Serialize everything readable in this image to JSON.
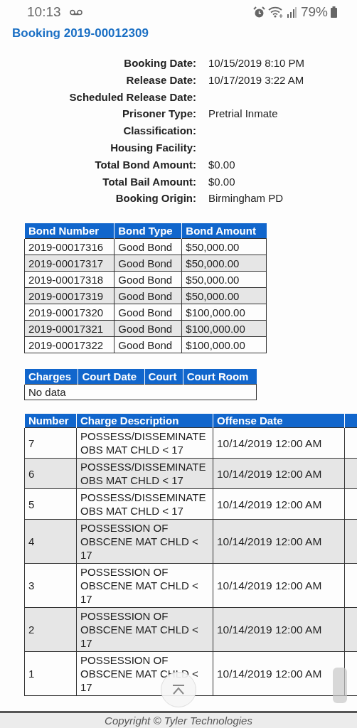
{
  "status_bar": {
    "time": "10:13",
    "battery": "79%"
  },
  "title": "Booking 2019-00012309",
  "details": [
    {
      "label": "Booking Date:",
      "value": "10/15/2019 8:10 PM"
    },
    {
      "label": "Release Date:",
      "value": "10/17/2019 3:22 AM"
    },
    {
      "label": "Scheduled Release Date:"
    },
    {
      "label": "Prisoner Type:",
      "value": "Pretrial Inmate"
    },
    {
      "label": "Classification:"
    },
    {
      "label": "Housing Facility:"
    },
    {
      "label": "Total Bond Amount:",
      "value": "$0.00"
    },
    {
      "label": "Total Bail Amount:",
      "value": "$0.00"
    },
    {
      "label": "Booking Origin:",
      "value": "Birmingham PD"
    }
  ],
  "bonds": {
    "columns": [
      "Bond Number",
      "Bond Type",
      "Bond Amount"
    ],
    "rows": [
      [
        "2019-00017316",
        "Good Bond",
        "$50,000.00"
      ],
      [
        "2019-00017317",
        "Good Bond",
        "$50,000.00"
      ],
      [
        "2019-00017318",
        "Good Bond",
        "$50,000.00"
      ],
      [
        "2019-00017319",
        "Good Bond",
        "$50,000.00"
      ],
      [
        "2019-00017320",
        "Good Bond",
        "$100,000.00"
      ],
      [
        "2019-00017321",
        "Good Bond",
        "$100,000.00"
      ],
      [
        "2019-00017322",
        "Good Bond",
        "$100,000.00"
      ]
    ]
  },
  "court": {
    "columns": [
      "Charges",
      "Court Date",
      "Court",
      "Court Room"
    ],
    "empty_text": "No data"
  },
  "charges": {
    "columns": [
      "Number",
      "Charge Description",
      "Offense Date"
    ],
    "rows": [
      [
        "7",
        "POSSESS/DISSEMINATE OBS MAT CHLD < 17",
        "10/14/2019 12:00 AM"
      ],
      [
        "6",
        "POSSESS/DISSEMINATE OBS MAT CHLD < 17",
        "10/14/2019 12:00 AM"
      ],
      [
        "5",
        "POSSESS/DISSEMINATE OBS MAT CHLD < 17",
        "10/14/2019 12:00 AM"
      ],
      [
        "4",
        "POSSESSION OF OBSCENE MAT CHLD < 17",
        "10/14/2019 12:00 AM"
      ],
      [
        "3",
        "POSSESSION OF OBSCENE MAT CHLD < 17",
        "10/14/2019 12:00 AM"
      ],
      [
        "2",
        "POSSESSION OF OBSCENE MAT CHLD < 17",
        "10/14/2019 12:00 AM"
      ],
      [
        "1",
        "POSSESSION OF OBSCENE MAT CHLD < 17",
        "10/14/2019 12:00 AM"
      ]
    ]
  },
  "footer": "Copyright © Tyler Technologies"
}
